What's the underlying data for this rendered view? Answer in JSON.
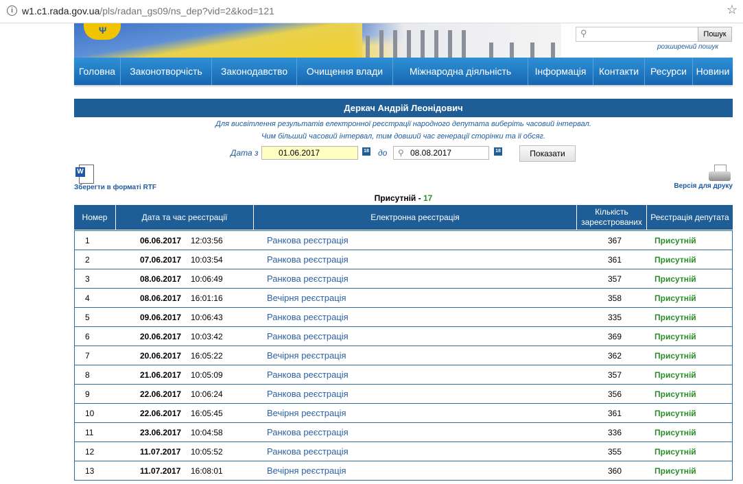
{
  "browser": {
    "url_host": "w1.c1.rada.gov.ua",
    "url_path": "/pls/radan_gs09/ns_dep?vid=2&kod=121"
  },
  "search": {
    "button_label": "Пошук",
    "advanced_label": "розширений пошук"
  },
  "nav": {
    "items": [
      "Головна",
      "Законотворчість",
      "Законодавство",
      "Очищення влади",
      "Міжнародна діяльність",
      "Інформація",
      "Контакти",
      "Ресурси",
      "Новини"
    ]
  },
  "page": {
    "title": "Деркач Андрій Леонідович",
    "note_line1": "Для висвітлення результатів електронної реєстрації народного депутата виберіть часовий інтервал.",
    "note_line2": "Чим більший часовий інтервал, тим довший час генерації сторінки та її обсяг.",
    "date_from_label": "Дата з",
    "date_from_value": "01.06.2017",
    "date_to_label": "до",
    "date_to_value": "08.08.2017",
    "show_button": "Показати",
    "rtf_link": "Зберегти в форматі RTF",
    "print_link": "Версія для друку",
    "present_label": "Присутній",
    "present_sep": " - ",
    "present_count": "17"
  },
  "table": {
    "headers": [
      "Номер",
      "Дата та час реєстрації",
      "Електронна реєстрація",
      "Кількість зареєстрованих",
      "Реєстрація депутата"
    ],
    "rows": [
      {
        "num": "1",
        "date": "06.06.2017",
        "time": "12:03:56",
        "reg": "Ранкова реєстрація",
        "count": "367",
        "status": "Присутній"
      },
      {
        "num": "2",
        "date": "07.06.2017",
        "time": "10:03:54",
        "reg": "Ранкова реєстрація",
        "count": "361",
        "status": "Присутній"
      },
      {
        "num": "3",
        "date": "08.06.2017",
        "time": "10:06:49",
        "reg": "Ранкова реєстрація",
        "count": "357",
        "status": "Присутній"
      },
      {
        "num": "4",
        "date": "08.06.2017",
        "time": "16:01:16",
        "reg": "Вечірня реєстрація",
        "count": "358",
        "status": "Присутній"
      },
      {
        "num": "5",
        "date": "09.06.2017",
        "time": "10:06:43",
        "reg": "Ранкова реєстрація",
        "count": "335",
        "status": "Присутній"
      },
      {
        "num": "6",
        "date": "20.06.2017",
        "time": "10:03:42",
        "reg": "Ранкова реєстрація",
        "count": "369",
        "status": "Присутній"
      },
      {
        "num": "7",
        "date": "20.06.2017",
        "time": "16:05:22",
        "reg": "Вечірня реєстрація",
        "count": "362",
        "status": "Присутній"
      },
      {
        "num": "8",
        "date": "21.06.2017",
        "time": "10:05:09",
        "reg": "Ранкова реєстрація",
        "count": "357",
        "status": "Присутній"
      },
      {
        "num": "9",
        "date": "22.06.2017",
        "time": "10:06:24",
        "reg": "Ранкова реєстрація",
        "count": "356",
        "status": "Присутній"
      },
      {
        "num": "10",
        "date": "22.06.2017",
        "time": "16:05:45",
        "reg": "Вечірня реєстрація",
        "count": "361",
        "status": "Присутній"
      },
      {
        "num": "11",
        "date": "23.06.2017",
        "time": "10:04:58",
        "reg": "Ранкова реєстрація",
        "count": "336",
        "status": "Присутній"
      },
      {
        "num": "12",
        "date": "11.07.2017",
        "time": "10:05:52",
        "reg": "Ранкова реєстрація",
        "count": "355",
        "status": "Присутній"
      },
      {
        "num": "13",
        "date": "11.07.2017",
        "time": "16:08:01",
        "reg": "Вечірня реєстрація",
        "count": "360",
        "status": "Присутній"
      }
    ]
  },
  "colors": {
    "header_blue": "#1e5d96",
    "nav_blue": "#1668b0",
    "link_blue": "#2c62a4",
    "status_green": "#2a8f2a",
    "date_from_bg": "#ffffc4"
  },
  "icons": [
    "info-icon",
    "bookmark-star-icon",
    "crest-icon",
    "search-icon",
    "calendar-icon",
    "word-document-icon",
    "printer-icon"
  ]
}
